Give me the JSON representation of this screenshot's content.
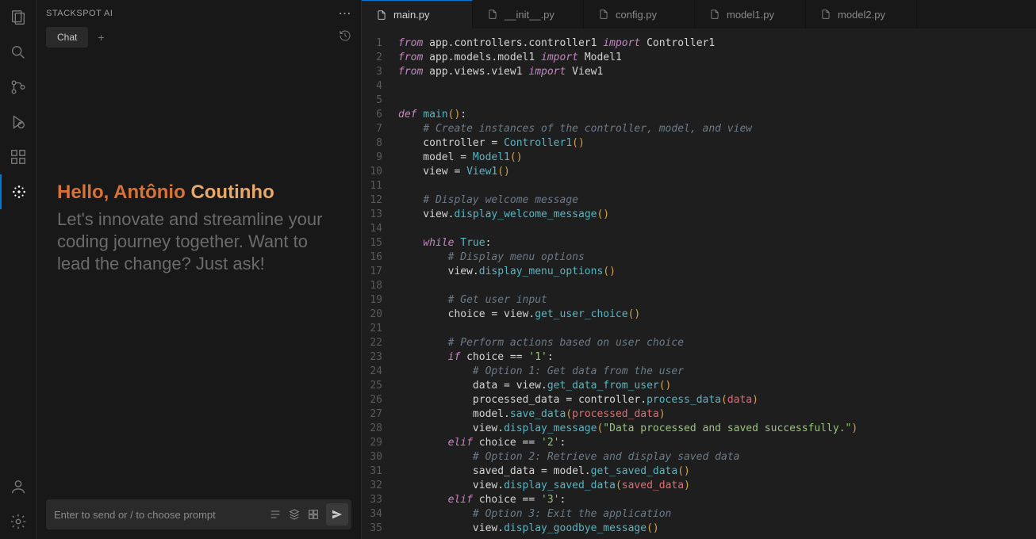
{
  "panel": {
    "title": "STACKSPOT AI",
    "tab_label": "Chat",
    "input_placeholder": "Enter to send or / to choose prompt"
  },
  "greeting": {
    "prefix": "Hello, ",
    "first": "Antônio ",
    "last": "Coutinho",
    "sub": "Let's innovate and streamline your coding journey together. Want to lead the change? Just ask!"
  },
  "tabs": [
    {
      "label": "main.py",
      "active": true
    },
    {
      "label": "__init__.py",
      "active": false
    },
    {
      "label": "config.py",
      "active": false
    },
    {
      "label": "model1.py",
      "active": false
    },
    {
      "label": "model2.py",
      "active": false
    }
  ],
  "code_lines": [
    [
      [
        "k-keyword",
        "from"
      ],
      [
        "",
        " app.controllers.controller1 "
      ],
      [
        "k-keyword",
        "import"
      ],
      [
        "",
        " Controller1"
      ]
    ],
    [
      [
        "k-keyword",
        "from"
      ],
      [
        "",
        " app.models.model1 "
      ],
      [
        "k-keyword",
        "import"
      ],
      [
        "",
        " Model1"
      ]
    ],
    [
      [
        "k-keyword",
        "from"
      ],
      [
        "",
        " app.views.view1 "
      ],
      [
        "k-keyword",
        "import"
      ],
      [
        "",
        " View1"
      ]
    ],
    [
      [
        "",
        ""
      ]
    ],
    [
      [
        "",
        ""
      ]
    ],
    [
      [
        "k-keyword",
        "def"
      ],
      [
        "",
        " "
      ],
      [
        "k-call",
        "main"
      ],
      [
        "k-punct",
        "()"
      ],
      [
        "",
        ":"
      ]
    ],
    [
      [
        "",
        "    "
      ],
      [
        "k-comment",
        "# Create instances of the controller, model, and view"
      ]
    ],
    [
      [
        "",
        "    controller = "
      ],
      [
        "k-class",
        "Controller1"
      ],
      [
        "k-punct",
        "()"
      ]
    ],
    [
      [
        "",
        "    model = "
      ],
      [
        "k-class",
        "Model1"
      ],
      [
        "k-punct",
        "()"
      ]
    ],
    [
      [
        "",
        "    view = "
      ],
      [
        "k-class",
        "View1"
      ],
      [
        "k-punct",
        "()"
      ]
    ],
    [
      [
        "",
        ""
      ]
    ],
    [
      [
        "",
        "    "
      ],
      [
        "k-comment",
        "# Display welcome message"
      ]
    ],
    [
      [
        "",
        "    view."
      ],
      [
        "k-call",
        "display_welcome_message"
      ],
      [
        "k-punct",
        "()"
      ]
    ],
    [
      [
        "",
        ""
      ]
    ],
    [
      [
        "",
        "    "
      ],
      [
        "k-keyword",
        "while"
      ],
      [
        "",
        " "
      ],
      [
        "k-const",
        "True"
      ],
      [
        "",
        ":"
      ]
    ],
    [
      [
        "",
        "        "
      ],
      [
        "k-comment",
        "# Display menu options"
      ]
    ],
    [
      [
        "",
        "        view."
      ],
      [
        "k-call",
        "display_menu_options"
      ],
      [
        "k-punct",
        "()"
      ]
    ],
    [
      [
        "",
        ""
      ]
    ],
    [
      [
        "",
        "        "
      ],
      [
        "k-comment",
        "# Get user input"
      ]
    ],
    [
      [
        "",
        "        choice = view."
      ],
      [
        "k-call",
        "get_user_choice"
      ],
      [
        "k-punct",
        "()"
      ]
    ],
    [
      [
        "",
        ""
      ]
    ],
    [
      [
        "",
        "        "
      ],
      [
        "k-comment",
        "# Perform actions based on user choice"
      ]
    ],
    [
      [
        "",
        "        "
      ],
      [
        "k-keyword",
        "if"
      ],
      [
        "",
        " choice == "
      ],
      [
        "k-str",
        "'1'"
      ],
      [
        "",
        ":"
      ]
    ],
    [
      [
        "",
        "            "
      ],
      [
        "k-comment",
        "# Option 1: Get data from the user"
      ]
    ],
    [
      [
        "",
        "            data = view."
      ],
      [
        "k-call",
        "get_data_from_user"
      ],
      [
        "k-punct",
        "()"
      ]
    ],
    [
      [
        "",
        "            processed_data = controller."
      ],
      [
        "k-call",
        "process_data"
      ],
      [
        "k-punct",
        "("
      ],
      [
        "k-param",
        "data"
      ],
      [
        "k-punct",
        ")"
      ]
    ],
    [
      [
        "",
        "            model."
      ],
      [
        "k-call",
        "save_data"
      ],
      [
        "k-punct",
        "("
      ],
      [
        "k-param",
        "processed_data"
      ],
      [
        "k-punct",
        ")"
      ]
    ],
    [
      [
        "",
        "            view."
      ],
      [
        "k-call",
        "display_message"
      ],
      [
        "k-punct",
        "("
      ],
      [
        "k-str",
        "\"Data processed and saved successfully.\""
      ],
      [
        "k-punct",
        ")"
      ]
    ],
    [
      [
        "",
        "        "
      ],
      [
        "k-keyword",
        "elif"
      ],
      [
        "",
        " choice == "
      ],
      [
        "k-str",
        "'2'"
      ],
      [
        "",
        ":"
      ]
    ],
    [
      [
        "",
        "            "
      ],
      [
        "k-comment",
        "# Option 2: Retrieve and display saved data"
      ]
    ],
    [
      [
        "",
        "            saved_data = model."
      ],
      [
        "k-call",
        "get_saved_data"
      ],
      [
        "k-punct",
        "()"
      ]
    ],
    [
      [
        "",
        "            view."
      ],
      [
        "k-call",
        "display_saved_data"
      ],
      [
        "k-punct",
        "("
      ],
      [
        "k-param",
        "saved_data"
      ],
      [
        "k-punct",
        ")"
      ]
    ],
    [
      [
        "",
        "        "
      ],
      [
        "k-keyword",
        "elif"
      ],
      [
        "",
        " choice == "
      ],
      [
        "k-str",
        "'3'"
      ],
      [
        "",
        ":"
      ]
    ],
    [
      [
        "",
        "            "
      ],
      [
        "k-comment",
        "# Option 3: Exit the application"
      ]
    ],
    [
      [
        "",
        "            view."
      ],
      [
        "k-call",
        "display_goodbye_message"
      ],
      [
        "k-punct",
        "()"
      ]
    ]
  ]
}
